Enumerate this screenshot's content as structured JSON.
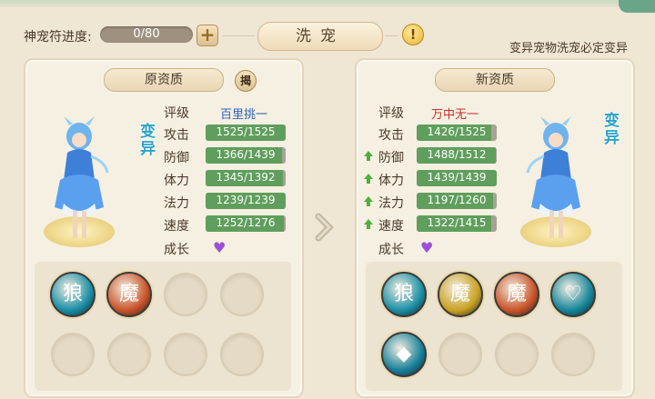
{
  "header": {
    "progress_label": "神宠符进度:",
    "progress_text": "0/80",
    "progress_fraction": 0,
    "plus_icon": "plus-icon",
    "wash_button_label": "洗宠",
    "warn_icon": "exclamation-icon",
    "warn_glyph": "!",
    "hint_text": "变异宠物洗宠必定变异"
  },
  "left_panel": {
    "title": "原资质",
    "reveal_label": "揭",
    "mutate_tag": "变异",
    "grade_label": "评级",
    "grade_value": "百里挑一",
    "grade_color": "#2f62b7",
    "stats": [
      {
        "label": "攻击",
        "text": "1525/1525",
        "fraction": 1.0
      },
      {
        "label": "防御",
        "text": "1366/1439",
        "fraction": 0.949
      },
      {
        "label": "体力",
        "text": "1345/1392",
        "fraction": 0.966
      },
      {
        "label": "法力",
        "text": "1239/1239",
        "fraction": 1.0
      },
      {
        "label": "速度",
        "text": "1252/1276",
        "fraction": 0.981
      }
    ],
    "growth_label": "成长",
    "growth_icon": "purple-heart-icon",
    "skills": [
      {
        "name": "skill-icon-wolf",
        "bg": "#1a8fa6",
        "glyph": "狼"
      },
      {
        "name": "skill-icon-demon",
        "bg": "#c9542a",
        "glyph": "魔"
      }
    ]
  },
  "right_panel": {
    "title": "新资质",
    "mutate_tag": "变异",
    "grade_label": "评级",
    "grade_value": "万中无一",
    "grade_color": "#c9302c",
    "stats": [
      {
        "label": "攻击",
        "text": "1426/1525",
        "fraction": 0.935,
        "up": false
      },
      {
        "label": "防御",
        "text": "1488/1512",
        "fraction": 0.984,
        "up": true
      },
      {
        "label": "体力",
        "text": "1439/1439",
        "fraction": 1.0,
        "up": true
      },
      {
        "label": "法力",
        "text": "1197/1260",
        "fraction": 0.95,
        "up": true
      },
      {
        "label": "速度",
        "text": "1322/1415",
        "fraction": 0.934,
        "up": true
      }
    ],
    "growth_label": "成长",
    "growth_icon": "purple-heart-icon",
    "skills": [
      {
        "name": "skill-icon-wolf",
        "bg": "#1a8fa6",
        "glyph": "狼"
      },
      {
        "name": "skill-icon-golden-demon",
        "bg": "#c9a224",
        "glyph": "魔"
      },
      {
        "name": "skill-icon-demon",
        "bg": "#c9542a",
        "glyph": "魔"
      },
      {
        "name": "skill-icon-heart",
        "bg": "#15869a",
        "glyph": "♡"
      },
      {
        "name": "skill-icon-crystal",
        "bg": "#17809a",
        "glyph": "◆"
      }
    ]
  },
  "colors": {
    "stat_fill": "#5f9e5c",
    "up_arrow": "#4fae3c",
    "mutate_text": "#2aa3c9"
  }
}
